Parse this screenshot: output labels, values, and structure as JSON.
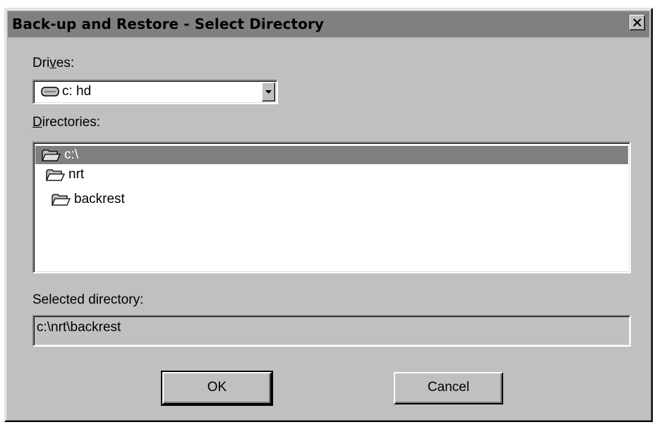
{
  "window": {
    "title": "Back-up and Restore - Select Directory"
  },
  "drives": {
    "label_prefix": "Dri",
    "label_hotkey": "v",
    "label_suffix": "es:",
    "selected_value": "c: hd"
  },
  "directories": {
    "label_hotkey": "D",
    "label_suffix": "irectories:",
    "items": [
      {
        "label": "c:\\",
        "selected": true,
        "icon": "open-folder-icon"
      },
      {
        "label": "nrt",
        "selected": false,
        "icon": "open-folder-icon"
      },
      {
        "label": "backrest",
        "selected": false,
        "icon": "open-folder-icon"
      }
    ]
  },
  "selected_directory": {
    "label": "Selected directory:",
    "value": "c:\\nrt\\backrest"
  },
  "buttons": {
    "ok_label": "OK",
    "cancel_label": "Cancel"
  },
  "colors": {
    "face": "#c0c0c0",
    "shadow": "#808080",
    "highlight": "#ffffff",
    "selection": "#808080"
  }
}
